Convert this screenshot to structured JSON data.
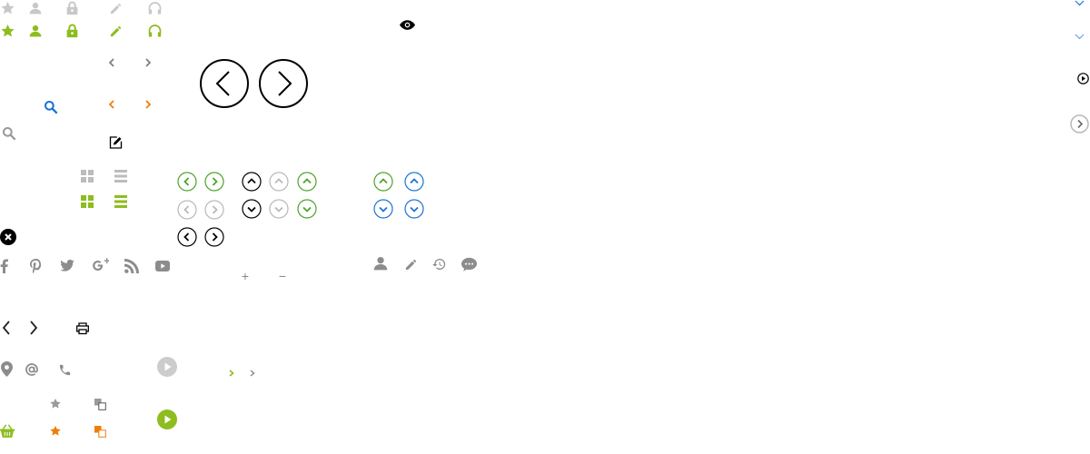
{
  "colors": {
    "gray": "#b8b8b8",
    "darkgray": "#8c8c8c",
    "green": "#8dbd1e",
    "ring_green": "#4ca32a",
    "blue": "#1a73d9",
    "orange": "#f07d0a",
    "black": "#000000"
  },
  "icons": [
    "star-icon",
    "user-icon",
    "lock-icon",
    "pencil-icon",
    "headphones-icon",
    "chevron-left-icon",
    "chevron-right-icon",
    "search-icon",
    "edit-icon",
    "grid-view-icon",
    "list-view-icon",
    "close-icon",
    "facebook-icon",
    "pinterest-icon",
    "twitter-icon",
    "google-plus-icon",
    "rss-icon",
    "youtube-icon",
    "print-icon",
    "location-pin-icon",
    "at-icon",
    "phone-icon",
    "play-icon",
    "copy-icon",
    "basket-icon",
    "eye-icon",
    "history-icon",
    "comment-icon",
    "chevron-down-icon",
    "chevron-up-icon"
  ],
  "controls": {
    "plus_label": "+",
    "minus_label": "−"
  }
}
